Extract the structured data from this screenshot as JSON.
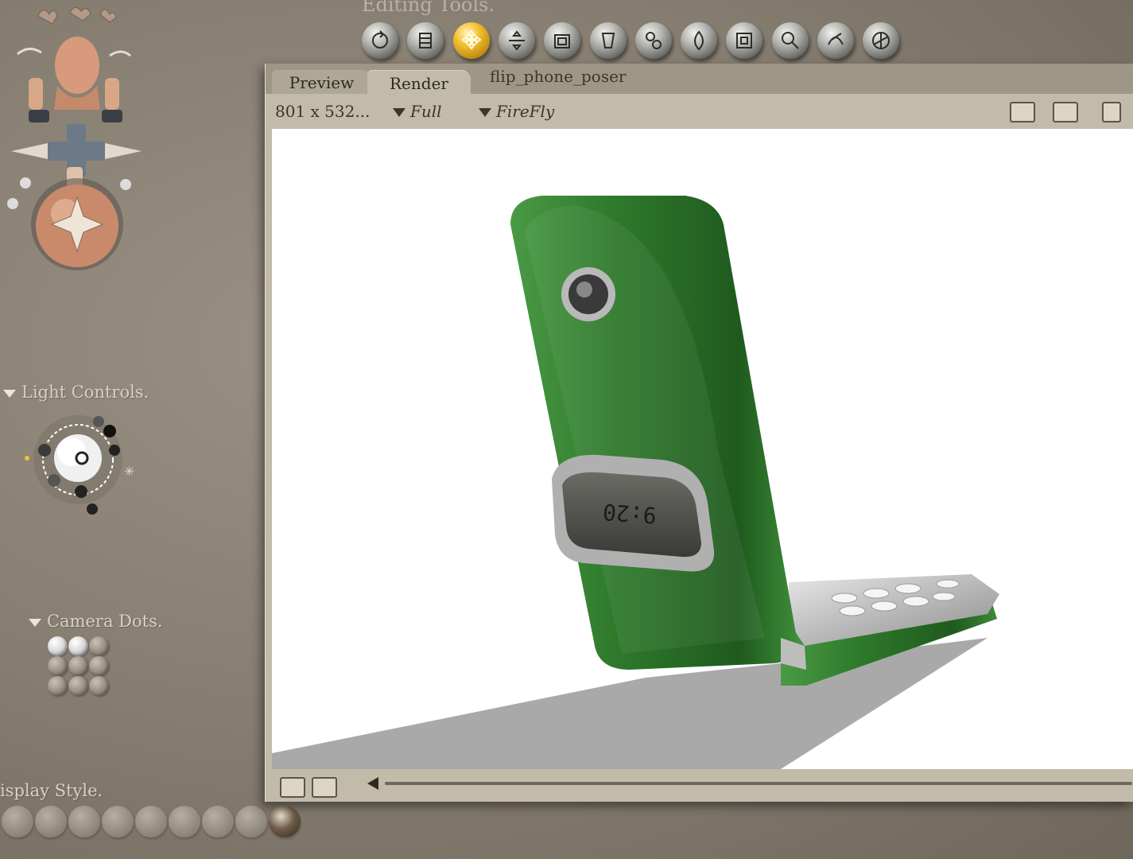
{
  "editing_tools": {
    "title": "Editing Tools.",
    "tools": [
      {
        "icon": "rotate-icon"
      },
      {
        "icon": "twist-icon"
      },
      {
        "icon": "translate-icon",
        "active": true
      },
      {
        "icon": "translate-in-out-icon"
      },
      {
        "icon": "scale-icon"
      },
      {
        "icon": "taper-icon"
      },
      {
        "icon": "chain-break-icon"
      },
      {
        "icon": "color-icon"
      },
      {
        "icon": "grouping-icon"
      },
      {
        "icon": "view-magnifier-icon"
      },
      {
        "icon": "morphing-tool-icon"
      },
      {
        "icon": "direct-manipulation-icon"
      }
    ]
  },
  "left_panel": {
    "light_controls_label": "Light Controls.",
    "camera_dots_label": "Camera Dots.",
    "display_style_label": "isplay Style."
  },
  "document": {
    "tabs": [
      {
        "label": "Preview",
        "active": false
      },
      {
        "label": "Render",
        "active": true
      }
    ],
    "name": "flip_phone_poser",
    "resolution": "801 x 532...",
    "render_size": "Full",
    "render_engine": "FireFly"
  },
  "render": {
    "phone_display_time": "9:20",
    "phone_color": "#2f7a2c"
  },
  "colors": {
    "panel_bg": "#857c70",
    "window_bg": "#c2bba9",
    "active_tool": "#f2c233"
  }
}
